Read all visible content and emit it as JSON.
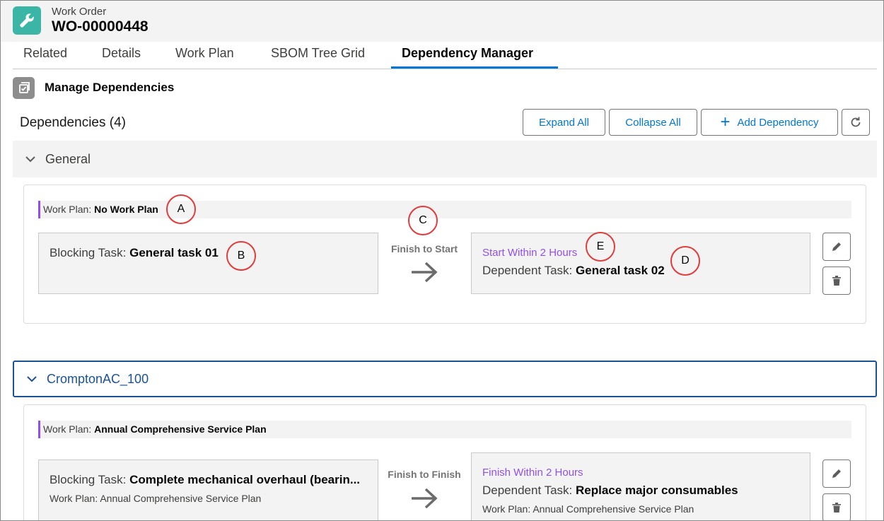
{
  "header": {
    "object_label": "Work Order",
    "record_name": "WO-00000448",
    "icon": "wrench-icon"
  },
  "tabs": [
    {
      "label": "Related"
    },
    {
      "label": "Details"
    },
    {
      "label": "Work Plan"
    },
    {
      "label": "SBOM Tree Grid"
    },
    {
      "label": "Dependency Manager",
      "active": true
    }
  ],
  "manage": {
    "title": "Manage Dependencies",
    "icon": "task-checkbox-icon"
  },
  "dependencies": {
    "count_label": "Dependencies (4)",
    "expand_all": "Expand All",
    "collapse_all": "Collapse All",
    "add_dependency": "Add Dependency",
    "add_icon": "plus-icon",
    "refresh_icon": "refresh-icon"
  },
  "groups": [
    {
      "label": "General",
      "dependency": {
        "work_plan_prefix": "Work Plan:",
        "work_plan_name": "No Work Plan",
        "blocking_prefix": "Blocking Task:",
        "blocking_task": "General task 01",
        "relationship": "Finish to Start",
        "timing": "Start Within 2 Hours",
        "dependent_prefix": "Dependent Task:",
        "dependent_task": "General task 02"
      }
    },
    {
      "label": "CromptonAC_100",
      "dependency": {
        "work_plan_prefix": "Work Plan:",
        "work_plan_name": "Annual Comprehensive Service Plan",
        "blocking_prefix": "Blocking Task:",
        "blocking_task": "Complete mechanical overhaul (bearin...",
        "blocking_work_plan": "Work Plan: Annual Comprehensive Service Plan",
        "relationship": "Finish to Finish",
        "timing": "Finish Within 2 Hours",
        "dependent_prefix": "Dependent Task:",
        "dependent_task": "Replace major consumables",
        "dependent_work_plan": "Work Plan: Annual Comprehensive Service Plan"
      }
    }
  ],
  "annotations": [
    "A",
    "B",
    "C",
    "D",
    "E"
  ],
  "colors": {
    "brand": "#0176d3",
    "timing": "#9050e9",
    "app_icon": "#3bb6a6",
    "annotation": "#e03c3c",
    "active_section": "#1b5297"
  }
}
